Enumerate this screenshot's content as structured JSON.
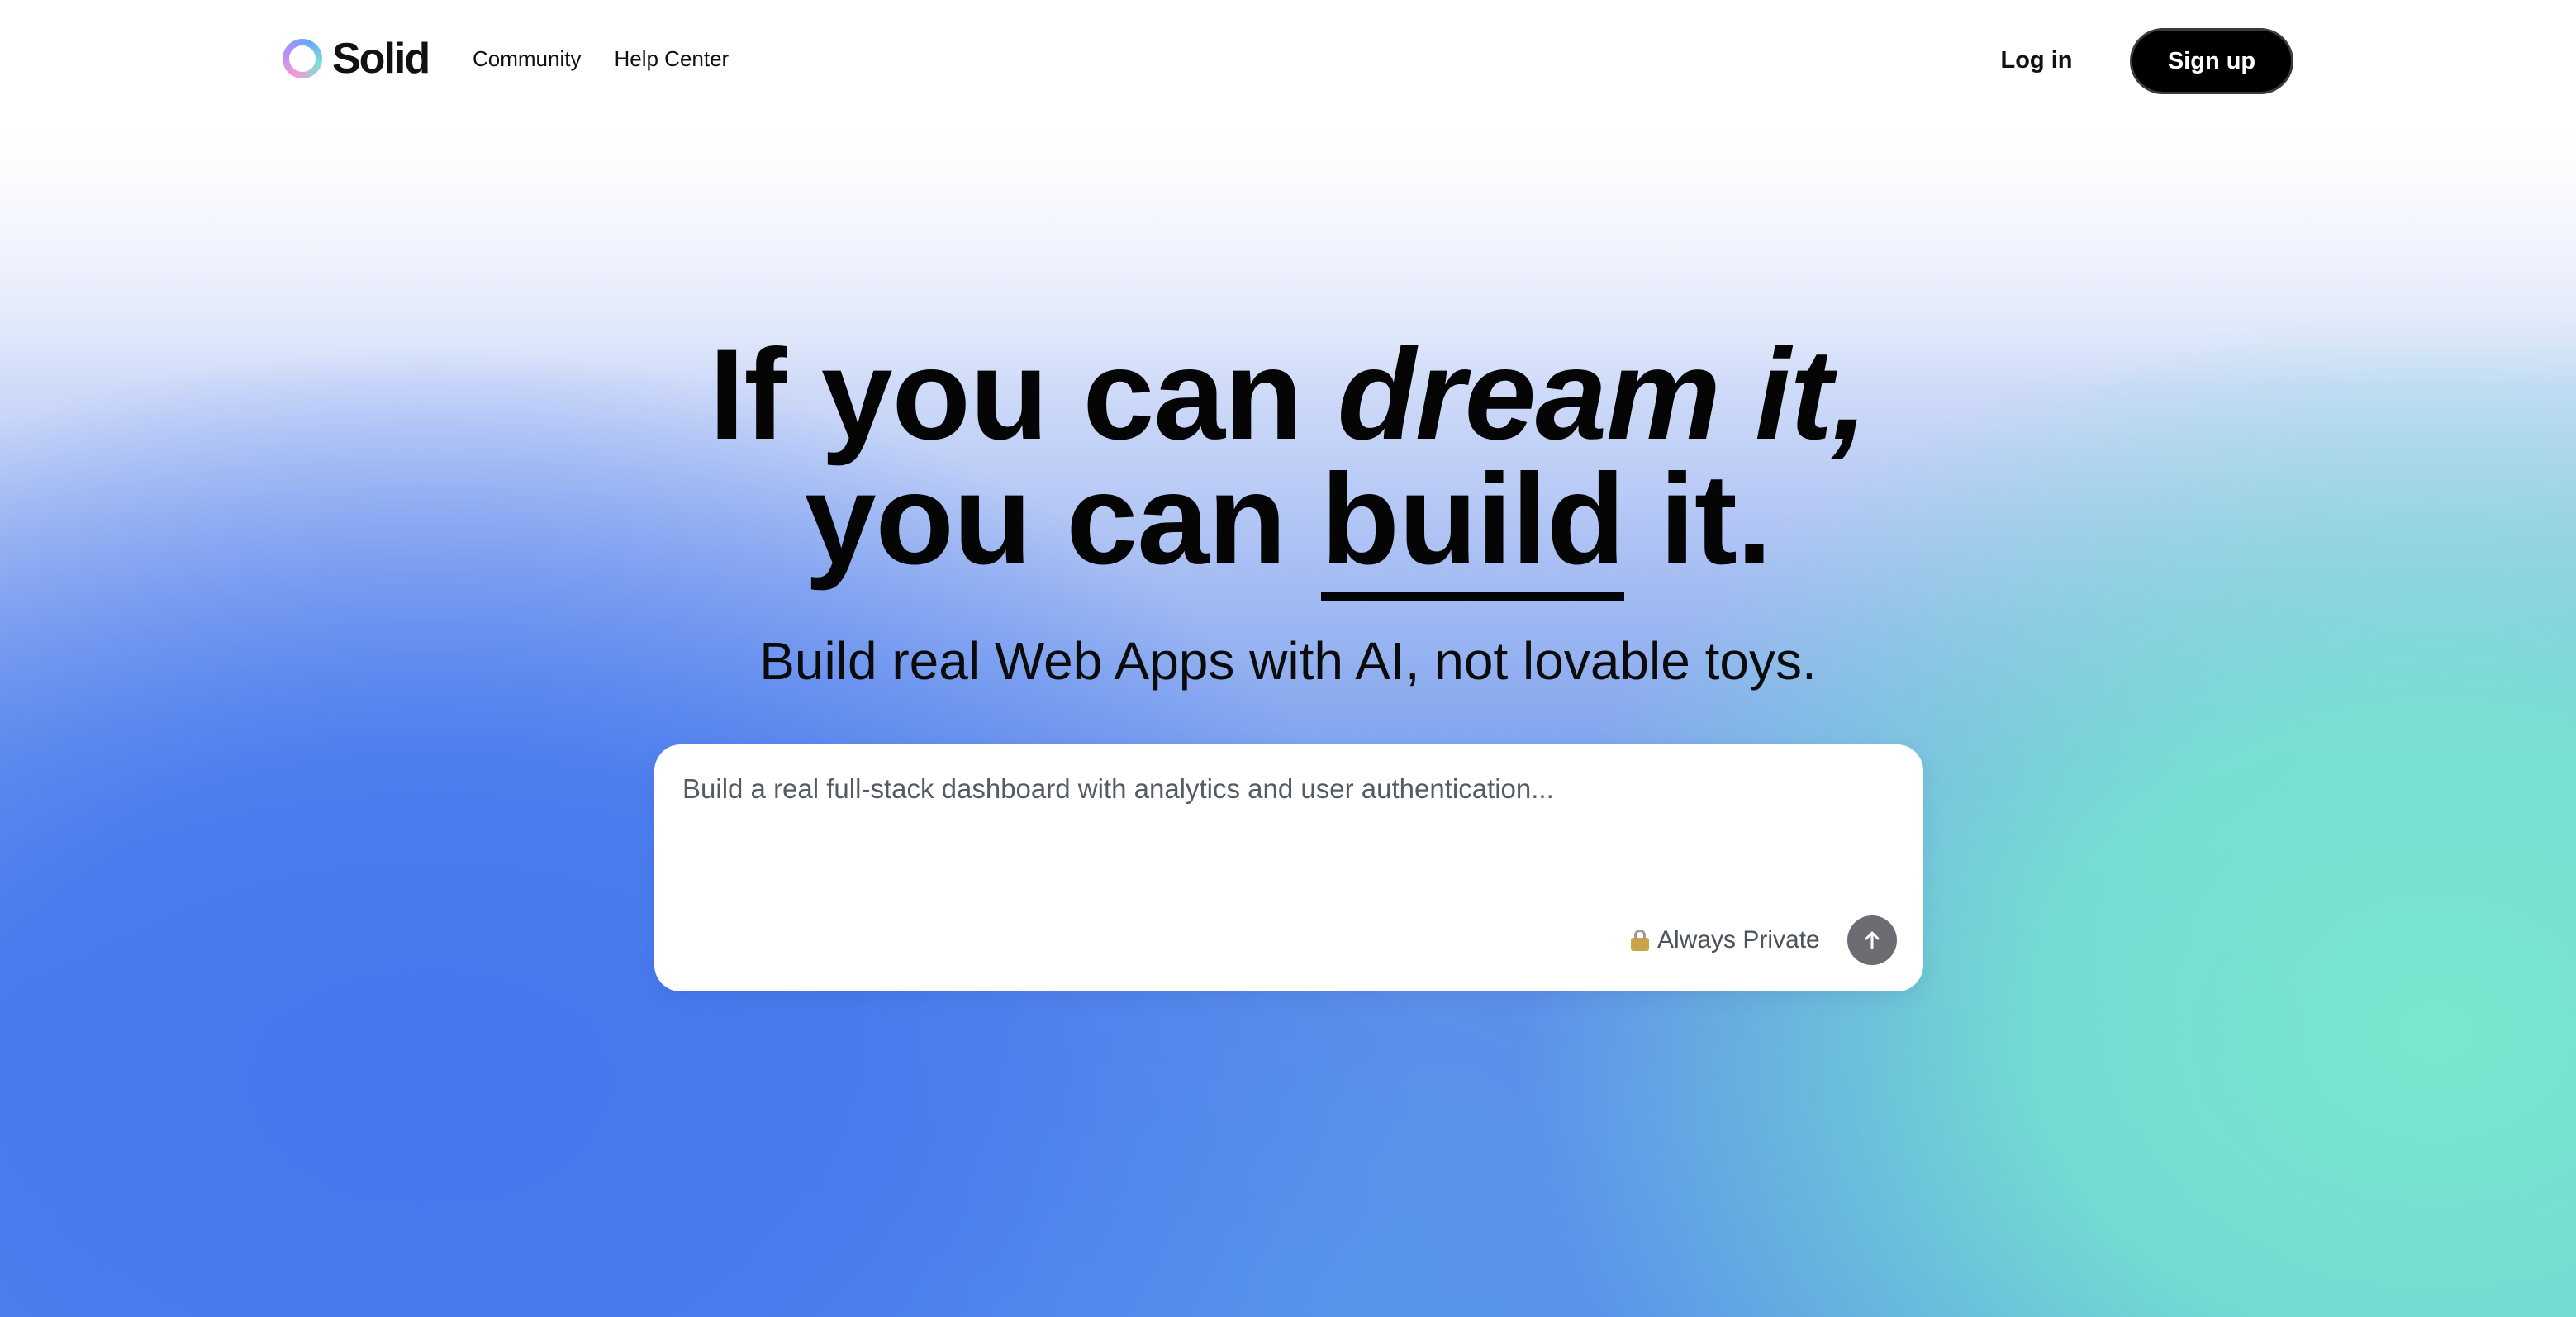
{
  "header": {
    "logo_text": "Solid",
    "nav": [
      {
        "label": "Community"
      },
      {
        "label": "Help Center"
      }
    ],
    "login_label": "Log in",
    "signup_label": "Sign up"
  },
  "hero": {
    "headline_line1_plain": "If you can ",
    "headline_line1_italic": "dream it,",
    "headline_line2_before": "you can ",
    "headline_line2_underlined": "build",
    "headline_line2_after": " it.",
    "subtitle": "Build real Web Apps with AI, not lovable toys."
  },
  "prompt": {
    "placeholder": "Build a real full-stack dashboard with analytics and user authentication...",
    "privacy_label": "Always Private",
    "lock_icon": "lock-icon",
    "send_icon": "arrow-up-icon"
  },
  "colors": {
    "gradient_blue": "#4678EE",
    "gradient_mint": "#78E8CE",
    "signup_bg": "#000000",
    "send_button": "#6B6D73"
  }
}
